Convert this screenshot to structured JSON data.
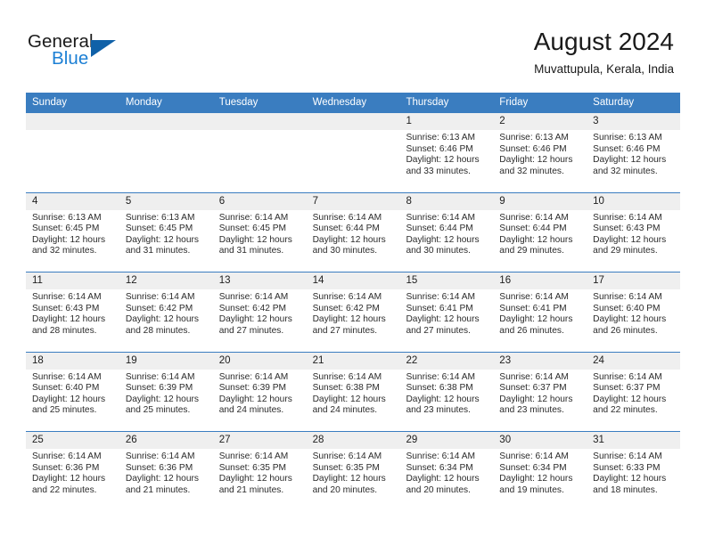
{
  "brand": {
    "line1": "General",
    "line2": "Blue",
    "triangle_color": "#1061a8",
    "blue_color": "#1b7fd4"
  },
  "header": {
    "title": "August 2024",
    "subtitle": "Muvattupula, Kerala, India"
  },
  "theme": {
    "header_row_bg": "#3a7dc0",
    "day_number_bg": "#efefef",
    "grid_line": "#3a7dc0",
    "text": "#2b2b2b"
  },
  "weekdays": [
    "Sunday",
    "Monday",
    "Tuesday",
    "Wednesday",
    "Thursday",
    "Friday",
    "Saturday"
  ],
  "weeks": [
    [
      {
        "day": "",
        "sunrise": "",
        "sunset": "",
        "daylight_l1": "",
        "daylight_l2": ""
      },
      {
        "day": "",
        "sunrise": "",
        "sunset": "",
        "daylight_l1": "",
        "daylight_l2": ""
      },
      {
        "day": "",
        "sunrise": "",
        "sunset": "",
        "daylight_l1": "",
        "daylight_l2": ""
      },
      {
        "day": "",
        "sunrise": "",
        "sunset": "",
        "daylight_l1": "",
        "daylight_l2": ""
      },
      {
        "day": "1",
        "sunrise": "Sunrise: 6:13 AM",
        "sunset": "Sunset: 6:46 PM",
        "daylight_l1": "Daylight: 12 hours",
        "daylight_l2": "and 33 minutes."
      },
      {
        "day": "2",
        "sunrise": "Sunrise: 6:13 AM",
        "sunset": "Sunset: 6:46 PM",
        "daylight_l1": "Daylight: 12 hours",
        "daylight_l2": "and 32 minutes."
      },
      {
        "day": "3",
        "sunrise": "Sunrise: 6:13 AM",
        "sunset": "Sunset: 6:46 PM",
        "daylight_l1": "Daylight: 12 hours",
        "daylight_l2": "and 32 minutes."
      }
    ],
    [
      {
        "day": "4",
        "sunrise": "Sunrise: 6:13 AM",
        "sunset": "Sunset: 6:45 PM",
        "daylight_l1": "Daylight: 12 hours",
        "daylight_l2": "and 32 minutes."
      },
      {
        "day": "5",
        "sunrise": "Sunrise: 6:13 AM",
        "sunset": "Sunset: 6:45 PM",
        "daylight_l1": "Daylight: 12 hours",
        "daylight_l2": "and 31 minutes."
      },
      {
        "day": "6",
        "sunrise": "Sunrise: 6:14 AM",
        "sunset": "Sunset: 6:45 PM",
        "daylight_l1": "Daylight: 12 hours",
        "daylight_l2": "and 31 minutes."
      },
      {
        "day": "7",
        "sunrise": "Sunrise: 6:14 AM",
        "sunset": "Sunset: 6:44 PM",
        "daylight_l1": "Daylight: 12 hours",
        "daylight_l2": "and 30 minutes."
      },
      {
        "day": "8",
        "sunrise": "Sunrise: 6:14 AM",
        "sunset": "Sunset: 6:44 PM",
        "daylight_l1": "Daylight: 12 hours",
        "daylight_l2": "and 30 minutes."
      },
      {
        "day": "9",
        "sunrise": "Sunrise: 6:14 AM",
        "sunset": "Sunset: 6:44 PM",
        "daylight_l1": "Daylight: 12 hours",
        "daylight_l2": "and 29 minutes."
      },
      {
        "day": "10",
        "sunrise": "Sunrise: 6:14 AM",
        "sunset": "Sunset: 6:43 PM",
        "daylight_l1": "Daylight: 12 hours",
        "daylight_l2": "and 29 minutes."
      }
    ],
    [
      {
        "day": "11",
        "sunrise": "Sunrise: 6:14 AM",
        "sunset": "Sunset: 6:43 PM",
        "daylight_l1": "Daylight: 12 hours",
        "daylight_l2": "and 28 minutes."
      },
      {
        "day": "12",
        "sunrise": "Sunrise: 6:14 AM",
        "sunset": "Sunset: 6:42 PM",
        "daylight_l1": "Daylight: 12 hours",
        "daylight_l2": "and 28 minutes."
      },
      {
        "day": "13",
        "sunrise": "Sunrise: 6:14 AM",
        "sunset": "Sunset: 6:42 PM",
        "daylight_l1": "Daylight: 12 hours",
        "daylight_l2": "and 27 minutes."
      },
      {
        "day": "14",
        "sunrise": "Sunrise: 6:14 AM",
        "sunset": "Sunset: 6:42 PM",
        "daylight_l1": "Daylight: 12 hours",
        "daylight_l2": "and 27 minutes."
      },
      {
        "day": "15",
        "sunrise": "Sunrise: 6:14 AM",
        "sunset": "Sunset: 6:41 PM",
        "daylight_l1": "Daylight: 12 hours",
        "daylight_l2": "and 27 minutes."
      },
      {
        "day": "16",
        "sunrise": "Sunrise: 6:14 AM",
        "sunset": "Sunset: 6:41 PM",
        "daylight_l1": "Daylight: 12 hours",
        "daylight_l2": "and 26 minutes."
      },
      {
        "day": "17",
        "sunrise": "Sunrise: 6:14 AM",
        "sunset": "Sunset: 6:40 PM",
        "daylight_l1": "Daylight: 12 hours",
        "daylight_l2": "and 26 minutes."
      }
    ],
    [
      {
        "day": "18",
        "sunrise": "Sunrise: 6:14 AM",
        "sunset": "Sunset: 6:40 PM",
        "daylight_l1": "Daylight: 12 hours",
        "daylight_l2": "and 25 minutes."
      },
      {
        "day": "19",
        "sunrise": "Sunrise: 6:14 AM",
        "sunset": "Sunset: 6:39 PM",
        "daylight_l1": "Daylight: 12 hours",
        "daylight_l2": "and 25 minutes."
      },
      {
        "day": "20",
        "sunrise": "Sunrise: 6:14 AM",
        "sunset": "Sunset: 6:39 PM",
        "daylight_l1": "Daylight: 12 hours",
        "daylight_l2": "and 24 minutes."
      },
      {
        "day": "21",
        "sunrise": "Sunrise: 6:14 AM",
        "sunset": "Sunset: 6:38 PM",
        "daylight_l1": "Daylight: 12 hours",
        "daylight_l2": "and 24 minutes."
      },
      {
        "day": "22",
        "sunrise": "Sunrise: 6:14 AM",
        "sunset": "Sunset: 6:38 PM",
        "daylight_l1": "Daylight: 12 hours",
        "daylight_l2": "and 23 minutes."
      },
      {
        "day": "23",
        "sunrise": "Sunrise: 6:14 AM",
        "sunset": "Sunset: 6:37 PM",
        "daylight_l1": "Daylight: 12 hours",
        "daylight_l2": "and 23 minutes."
      },
      {
        "day": "24",
        "sunrise": "Sunrise: 6:14 AM",
        "sunset": "Sunset: 6:37 PM",
        "daylight_l1": "Daylight: 12 hours",
        "daylight_l2": "and 22 minutes."
      }
    ],
    [
      {
        "day": "25",
        "sunrise": "Sunrise: 6:14 AM",
        "sunset": "Sunset: 6:36 PM",
        "daylight_l1": "Daylight: 12 hours",
        "daylight_l2": "and 22 minutes."
      },
      {
        "day": "26",
        "sunrise": "Sunrise: 6:14 AM",
        "sunset": "Sunset: 6:36 PM",
        "daylight_l1": "Daylight: 12 hours",
        "daylight_l2": "and 21 minutes."
      },
      {
        "day": "27",
        "sunrise": "Sunrise: 6:14 AM",
        "sunset": "Sunset: 6:35 PM",
        "daylight_l1": "Daylight: 12 hours",
        "daylight_l2": "and 21 minutes."
      },
      {
        "day": "28",
        "sunrise": "Sunrise: 6:14 AM",
        "sunset": "Sunset: 6:35 PM",
        "daylight_l1": "Daylight: 12 hours",
        "daylight_l2": "and 20 minutes."
      },
      {
        "day": "29",
        "sunrise": "Sunrise: 6:14 AM",
        "sunset": "Sunset: 6:34 PM",
        "daylight_l1": "Daylight: 12 hours",
        "daylight_l2": "and 20 minutes."
      },
      {
        "day": "30",
        "sunrise": "Sunrise: 6:14 AM",
        "sunset": "Sunset: 6:34 PM",
        "daylight_l1": "Daylight: 12 hours",
        "daylight_l2": "and 19 minutes."
      },
      {
        "day": "31",
        "sunrise": "Sunrise: 6:14 AM",
        "sunset": "Sunset: 6:33 PM",
        "daylight_l1": "Daylight: 12 hours",
        "daylight_l2": "and 18 minutes."
      }
    ]
  ]
}
